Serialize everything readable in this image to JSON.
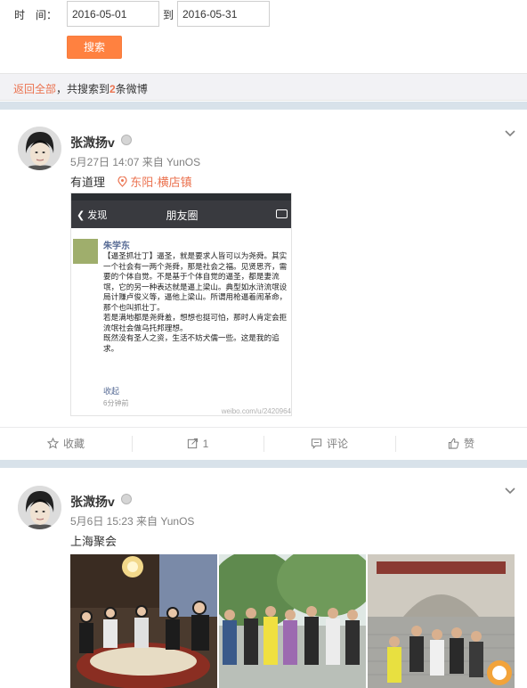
{
  "filter": {
    "time_label": "时　间：",
    "date_from": "2016-05-01",
    "to_label": "到",
    "date_to": "2016-05-31",
    "search_label": "搜索"
  },
  "result_bar": {
    "back_label": "返回全部",
    "prefix": "，共搜索到",
    "count": "2",
    "suffix": "条微博"
  },
  "colors": {
    "accent": "#ff8140",
    "link_orange": "#eb7350",
    "separator": "#d8e2ea",
    "meta_gray": "#808080"
  },
  "posts": [
    {
      "author": "张溦扬v",
      "meta": "5月27日 14:07 来自 YunOS",
      "text": "有道理",
      "location": "东阳·横店镇",
      "location_icon": "map-pin-icon",
      "screenshot": {
        "back": "发现",
        "title": "朋友圈",
        "author": "朱学东",
        "body": "【逼圣抓壮丁】逼圣，就是要求人皆可以为尧舜。其实一个社会有一两个尧舜，那是社会之福。见贤思齐，需要的个体自觉。不是基于个体自觉的逼圣，都是妻流氓，它的另一种表达就是逼上梁山。典型如水浒流氓设局计赚卢俊义等，逼他上梁山。所谓用枪逼着闹革命，那个也叫抓壮丁。\n若是满地都是尧舜羞，想想也挺可怕，那时人肯定会拒流氓社会做乌托邦理想。\n既然没有圣人之资，生活不妨犬儒一些。这是我的追求。",
        "fold": "收起",
        "time": "6分钟前",
        "watermark": "weibo.com/u/2420964"
      },
      "actions": {
        "favorite": "收藏",
        "repost_count": "1",
        "comment": "评论",
        "like": "赞"
      }
    },
    {
      "author": "张溦扬v",
      "meta": "5月6日 15:23 来自 YunOS",
      "text": "上海聚会"
    }
  ]
}
